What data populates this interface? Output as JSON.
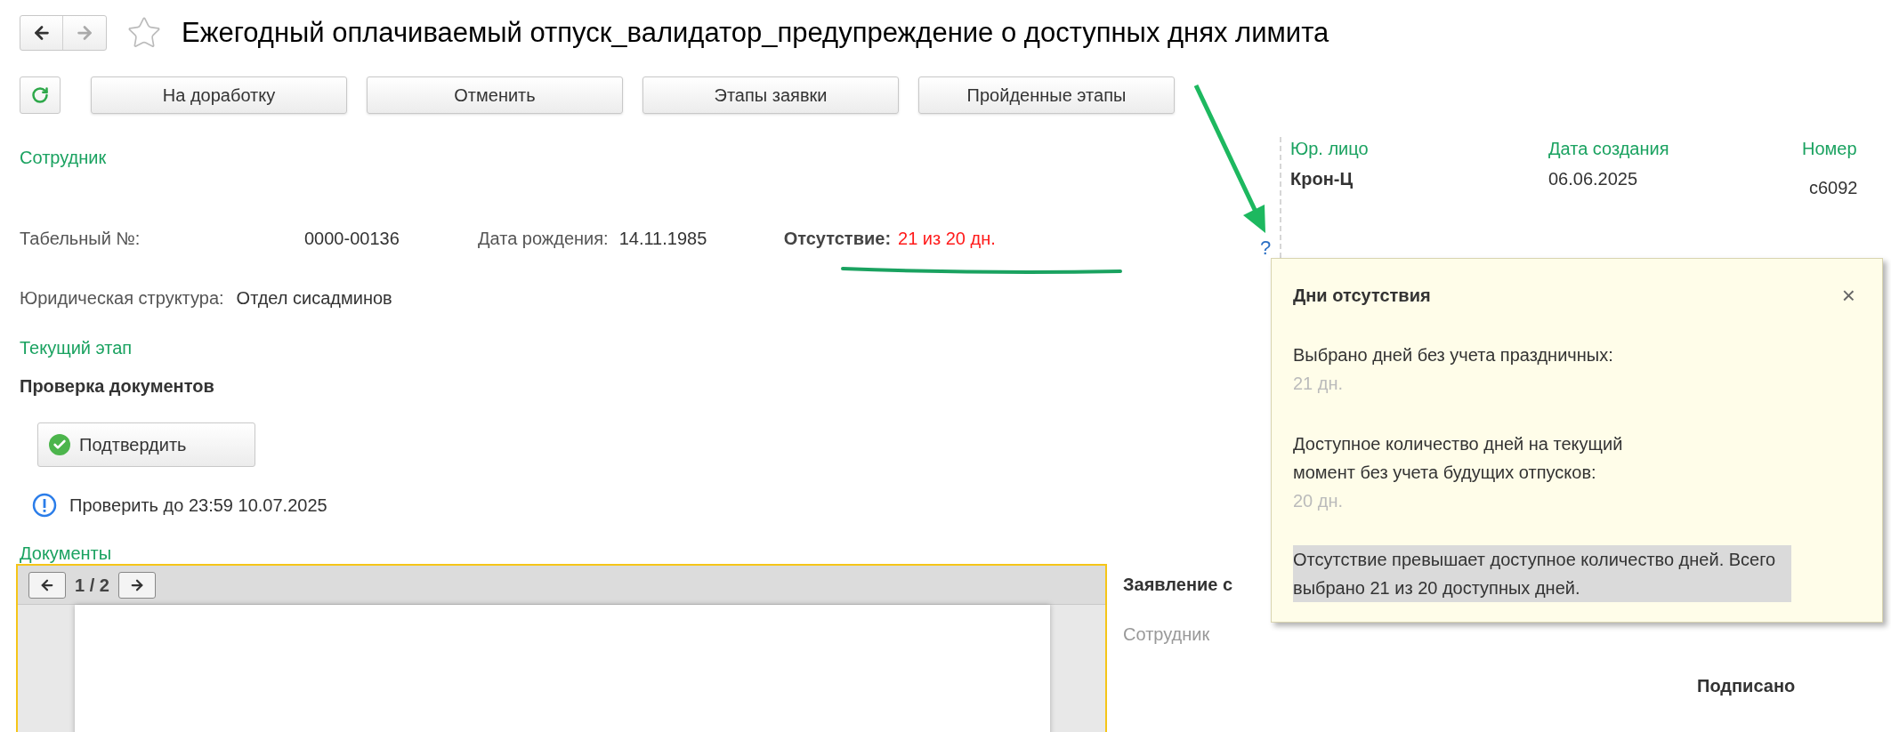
{
  "window": {
    "title": "Ежегодный оплачиваемый отпуск_валидатор_предупреждение о доступных днях лимита"
  },
  "toolbar": {
    "buttons": [
      "На доработку",
      "Отменить",
      "Этапы заявки",
      "Пройденные этапы"
    ]
  },
  "employee": {
    "label": "Сотрудник",
    "fields": [
      {
        "label": "Табельный №:",
        "value": "0000-00136"
      },
      {
        "label": "Дата рождения:",
        "value": "14.11.1985"
      }
    ],
    "absence": {
      "label": "Отсутствие:",
      "value": "21 из 20 дн.",
      "over_limit": true
    },
    "structure": {
      "label": "Юридическая структура:",
      "value": "Отдел сисадминов"
    }
  },
  "stage": {
    "label": "Текущий этап",
    "name": "Проверка документов",
    "confirm_button": "Подтвердить",
    "deadline": "Проверить до 23:59 10.07.2025"
  },
  "header_info": {
    "help": "?",
    "columns": [
      {
        "label": "Юр. лицо",
        "value": "Крон-Ц",
        "bold": true
      },
      {
        "label": "Дата создания",
        "value": "06.06.2025",
        "bold": false
      },
      {
        "label": "Номер",
        "value": "c6092",
        "bold": false
      }
    ]
  },
  "documents": {
    "label": "Документы",
    "pager": "1 / 2",
    "title": "Заявление с",
    "employee_label": "Сотрудник",
    "status": "Подписано"
  },
  "popup": {
    "title": "Дни отсутствия",
    "close": "×",
    "sections": [
      {
        "label": "Выбрано дней без учета праздничных:",
        "value": "21 дн."
      },
      {
        "label": "Доступное количество дней на текущий момент без учета будущих отпусков:",
        "value": "20 дн."
      }
    ],
    "warning": "Отсутствие превышает доступное количество дней. Всего выбрано 21 из 20 доступных дней.",
    "warning_highlighted": true
  }
}
